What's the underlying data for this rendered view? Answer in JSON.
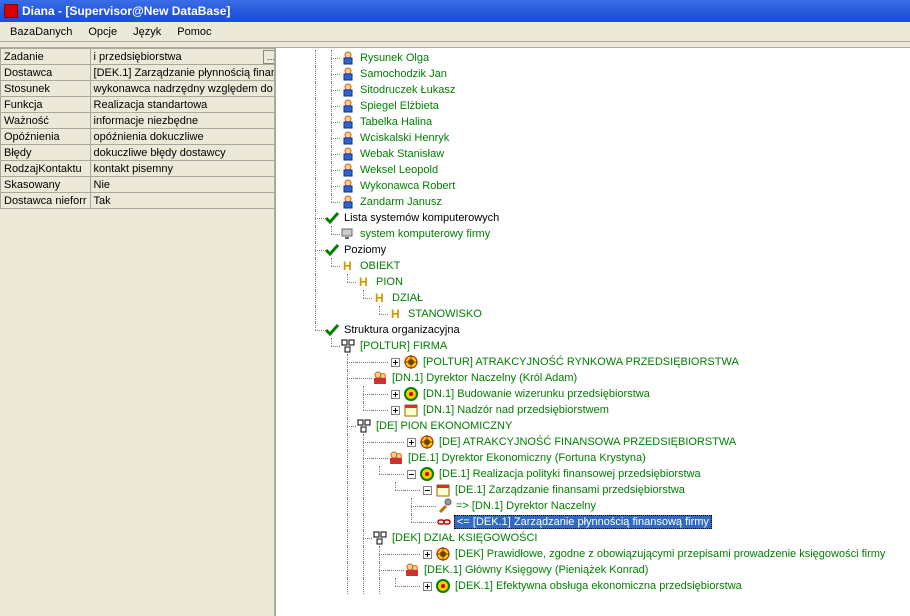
{
  "window": {
    "title": "Diana  -  [Supervisor@New DataBase]"
  },
  "menu": {
    "items": [
      "BazaDanych",
      "Opcje",
      "Język",
      "Pomoc"
    ]
  },
  "props": [
    {
      "label": "Zadanie",
      "value": "i przedsiębiorstwa",
      "has_dots": true
    },
    {
      "label": "Dostawca",
      "value": "[DEK.1] Zarządzanie płynnością finan"
    },
    {
      "label": "Stosunek",
      "value": "wykonawca nadrzędny względem do"
    },
    {
      "label": "Funkcja",
      "value": "Realizacja standartowa"
    },
    {
      "label": "Ważność",
      "value": "informacje niezbędne"
    },
    {
      "label": "Opóźnienia",
      "value": "opóźnienia dokuczliwe"
    },
    {
      "label": "Błędy",
      "value": "dokuczliwe błędy dostawcy"
    },
    {
      "label": "RodzajKontaktu",
      "value": "kontakt pisemny"
    },
    {
      "label": "Skasowany",
      "value": "Nie"
    },
    {
      "label": "Dostawca nieforr",
      "value": "Tak"
    }
  ],
  "tree": {
    "people": [
      "Rysunek Olga",
      "Samochodzik Jan",
      "Sitodruczek Łukasz",
      "Spiegel Elżbieta",
      "Tabelka Halina",
      "Wciskalski Henryk",
      "Webak Stanisław",
      "Weksel Leopold",
      "Wykonawca Robert",
      "Zandarm Janusz"
    ],
    "lista_label": "Lista systemów komputerowych",
    "system_label": "system komputerowy firmy",
    "poziomy_label": "Poziomy",
    "poziomy": [
      "OBIEKT",
      "PION",
      "DZIAŁ",
      "STANOWISKO"
    ],
    "struktura_label": "Struktura organizacyjna",
    "poltur_firma": "[POLTUR] FIRMA",
    "poltur_atr": "[POLTUR] ATRAKCYJNOŚĆ RYNKOWA PRZEDSIĘBIORSTWA",
    "dn1_dyr": "[DN.1] Dyrektor Naczelny (Król Adam)",
    "dn1_bud": "[DN.1] Budowanie wizerunku przedsiębiorstwa",
    "dn1_naz": "[DN.1] Nadzór nad przedsiębiorstwem",
    "de_pion": "[DE] PION EKONOMICZNY",
    "de_atr": "[DE] ATRAKCYJNOŚĆ FINANSOWA PRZEDSIĘBIORSTWA",
    "de1_dyr": "[DE.1] Dyrektor Ekonomiczny (Fortuna Krystyna)",
    "de1_real": "[DE.1] Realizacja polityki finansowej przedsiębiorstwa",
    "de1_zarz": "[DE.1] Zarządzanie finansami przedsiębiorstwa",
    "dn1_arrow": " => [DN.1] Dyrektor Naczelny",
    "dek1_sel": "<= [DEK.1] Zarządzanie płynnością finansową firmy",
    "dek_dzial": "[DEK] DZIAŁ KSIĘGOWOŚCI",
    "dek_praw": "[DEK] Prawidłowe, zgodne z obowiązującymi przepisami prowadzenie księgowości firmy",
    "dek1_glow": "[DEK.1] Główny Księgowy (Pieniążek Konrad)",
    "dek1_efek": "[DEK.1] Efektywna obsługa ekonomiczna przedsiębiorstwa"
  }
}
